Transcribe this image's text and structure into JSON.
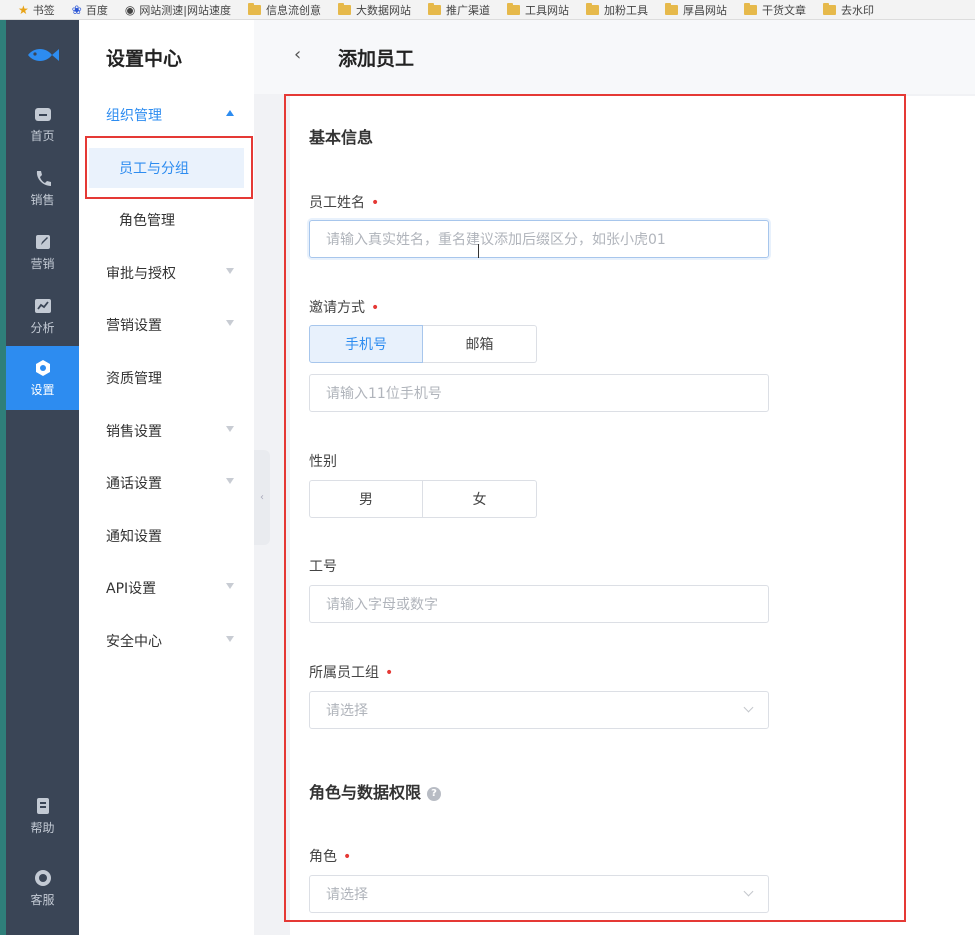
{
  "bookmarks": [
    {
      "label": "书签",
      "icon": "star-icon"
    },
    {
      "label": "百度",
      "icon": "baidu-paw-icon"
    },
    {
      "label": "网站测速|网站速度",
      "icon": "eye-icon"
    },
    {
      "label": "信息流创意",
      "icon": "folder-icon"
    },
    {
      "label": "大数据网站",
      "icon": "folder-icon"
    },
    {
      "label": "推广渠道",
      "icon": "folder-icon"
    },
    {
      "label": "工具网站",
      "icon": "folder-icon"
    },
    {
      "label": "加粉工具",
      "icon": "folder-icon"
    },
    {
      "label": "厚昌网站",
      "icon": "folder-icon"
    },
    {
      "label": "干货文章",
      "icon": "folder-icon"
    },
    {
      "label": "去水印",
      "icon": "folder-icon"
    }
  ],
  "iconbar": {
    "items": [
      {
        "label": "首页",
        "icon": "home-icon"
      },
      {
        "label": "销售",
        "icon": "phone-icon"
      },
      {
        "label": "营销",
        "icon": "edit-icon"
      },
      {
        "label": "分析",
        "icon": "chart-icon"
      },
      {
        "label": "设置",
        "icon": "settings-icon",
        "active": true
      }
    ],
    "bottom": [
      {
        "label": "帮助",
        "icon": "help-doc-icon"
      },
      {
        "label": "客服",
        "icon": "headset-icon"
      }
    ]
  },
  "submenu": {
    "title": "设置中心",
    "group": "组织管理",
    "group_items": [
      "员工与分组",
      "角色管理"
    ],
    "items": [
      "审批与授权",
      "营销设置",
      "资质管理",
      "销售设置",
      "通话设置",
      "通知设置",
      "API设置",
      "安全中心"
    ]
  },
  "header": {
    "title": "添加员工"
  },
  "form": {
    "section_basic": "基本信息",
    "name_label": "员工姓名",
    "name_placeholder": "请输入真实姓名，重名建议添加后缀区分，如张小虎01",
    "invite_label": "邀请方式",
    "invite_options": [
      "手机号",
      "邮箱"
    ],
    "phone_placeholder": "请输入11位手机号",
    "gender_label": "性别",
    "gender_options": [
      "男",
      "女"
    ],
    "id_label": "工号",
    "id_placeholder": "请输入字母或数字",
    "group_label": "所属员工组",
    "group_placeholder": "请选择",
    "section_role": "角色与数据权限",
    "role_label": "角色",
    "role_placeholder": "请选择",
    "required_mark": "•"
  },
  "colors": {
    "accent": "#2d8cf0",
    "highlight": "#e53935",
    "sidebar": "#3a4556"
  }
}
